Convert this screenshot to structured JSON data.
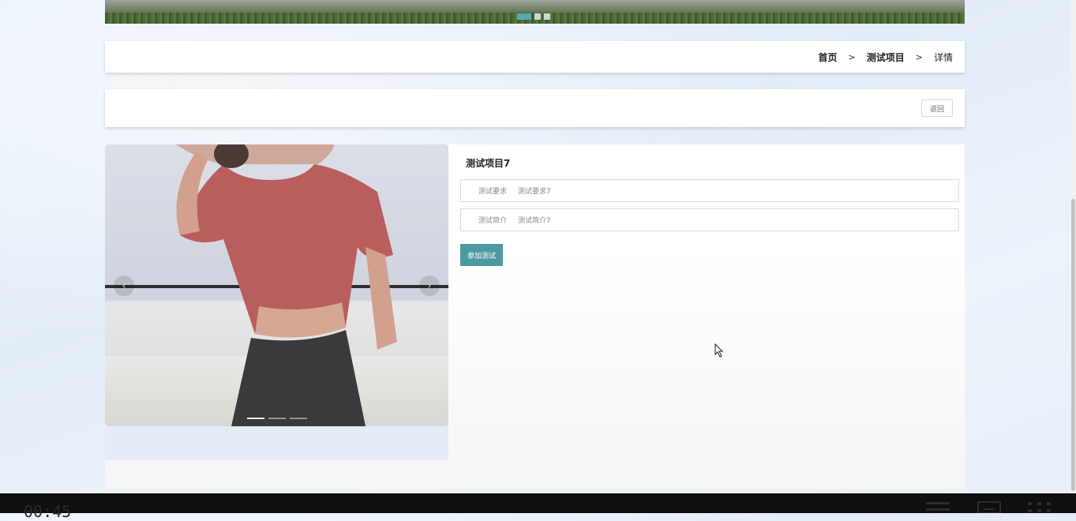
{
  "breadcrumb": {
    "home": "首页",
    "section": "测试项目",
    "current": "详情",
    "separator": ">"
  },
  "actions": {
    "back_label": "返回"
  },
  "banner": {
    "slide_count": 3,
    "active_slide": 1
  },
  "gallery": {
    "prev_icon": "‹",
    "next_icon": "›",
    "slide_count": 3,
    "active_slide": 1
  },
  "detail": {
    "title": "测试项目7",
    "fields": [
      {
        "label": "测试要求",
        "value": "测试要求7"
      },
      {
        "label": "测试简介",
        "value": "测试简介7"
      }
    ],
    "join_label": "参加测试"
  },
  "taskbar": {
    "time": "00:45"
  },
  "colors": {
    "accent": "#4e9aa3",
    "banner_dot_active": "#58a7b3"
  }
}
